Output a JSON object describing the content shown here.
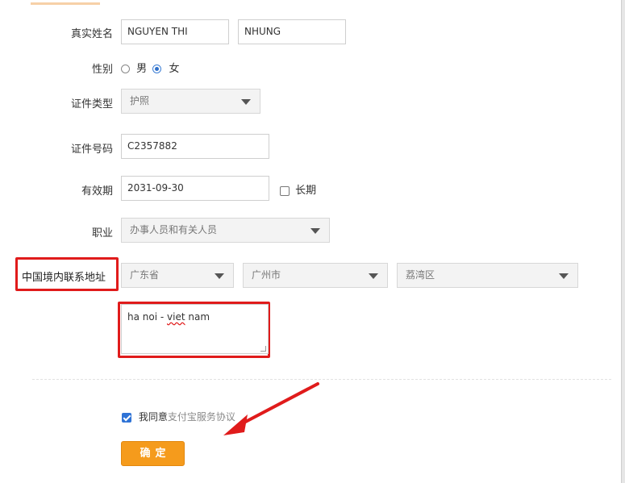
{
  "form": {
    "name": {
      "label": "真实姓名",
      "surname": "NGUYEN THI",
      "given": "NHUNG"
    },
    "gender": {
      "label": "性别",
      "options": [
        "男",
        "女"
      ],
      "selected": "女"
    },
    "id_type": {
      "label": "证件类型",
      "value": "护照"
    },
    "id_number": {
      "label": "证件号码",
      "value": "C2357882"
    },
    "expiry": {
      "label": "有效期",
      "value": "2031-09-30",
      "long_term_label": "长期",
      "long_term_checked": false
    },
    "occupation": {
      "label": "职业",
      "value": "办事人员和有关人员"
    },
    "address": {
      "label": "中国境内联系地址",
      "province": "广东省",
      "city": "广州市",
      "district": "荔湾区",
      "detail_prefix": "ha noi - ",
      "detail_misspelled": "viet",
      "detail_suffix": " nam"
    },
    "agreement": {
      "prefix": "我同意",
      "link": "支付宝服务协议",
      "checked": true
    },
    "confirm_label": "确定"
  },
  "colors": {
    "highlight_red": "#e01b1b",
    "button_orange": "#f59b1c",
    "checkbox_blue": "#2f73d6"
  }
}
